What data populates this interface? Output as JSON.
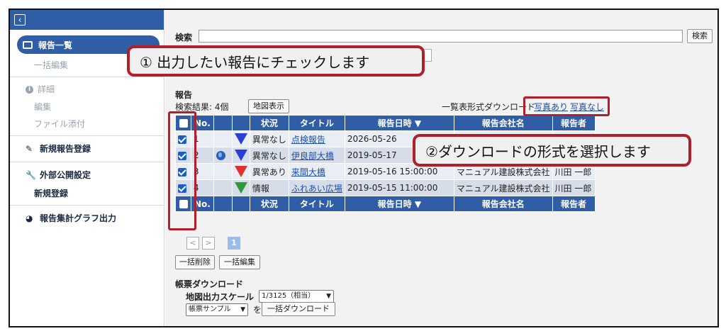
{
  "sidebar": {
    "back_icon": "chevron-left-icon",
    "active_label": "報告一覧",
    "bulk_edit": "一括編集",
    "detail": "詳細",
    "edit": "編集",
    "attach": "ファイル添付",
    "new_report": "新規報告登録",
    "public_settings": "外部公開設定",
    "new_register": "新規登録",
    "graph_output": "報告集計グラフ出力"
  },
  "search": {
    "label": "検索",
    "value": "",
    "button": "検索"
  },
  "report": {
    "title": "報告",
    "result": "検索結果: 4個",
    "map_button": "地図表示",
    "download_label": "一覧表形式ダウンロード",
    "link_with_photo": "写真あり",
    "link_without_photo": "写真なし"
  },
  "table": {
    "headers": [
      "No.",
      "状況",
      "タイトル",
      "報告日時 ▼",
      "報告会社名",
      "報告者"
    ],
    "rows": [
      {
        "no": "1",
        "status": "異常なし",
        "title": "点検報告",
        "date": "2026-05-26",
        "company": "",
        "reporter": ""
      },
      {
        "no": "2",
        "status": "異常なし",
        "title": "伊良部大橋",
        "date": "2019-05-17",
        "company": "",
        "reporter": ""
      },
      {
        "no": "3",
        "status": "異常あり",
        "title": "来間大橋",
        "date": "2019-05-16 15:00:00",
        "company": "マニュアル建設株式会社",
        "reporter": "川田 一郎"
      },
      {
        "no": "4",
        "status": "情報",
        "title": "ふれあい広場",
        "date": "2019-05-15 11:00:00",
        "company": "マニュアル建設株式会社",
        "reporter": "川田 一郎"
      }
    ],
    "footer_headers": [
      "No.",
      "状況",
      "タイトル",
      "報告日時 ▼",
      "報告会社名",
      "報告者"
    ]
  },
  "pager": {
    "prev": "<",
    "next": ">",
    "current": "1"
  },
  "actions": {
    "bulk_delete": "一括削除",
    "bulk_edit": "一括編集"
  },
  "forms": {
    "title": "帳票ダウンロード",
    "scale_label": "地図出力スケール",
    "scale_value": "1/3125（相当）",
    "sample_value": "帳票サンプル",
    "wo": "を",
    "bulk_download": "一括ダウンロード"
  },
  "callouts": {
    "one": "①  出力したい報告にチェックします",
    "two": "②ダウンロードの形式を選択します"
  },
  "colors": {
    "accent": "#2f5da6",
    "callout_border": "#b01f2c"
  }
}
